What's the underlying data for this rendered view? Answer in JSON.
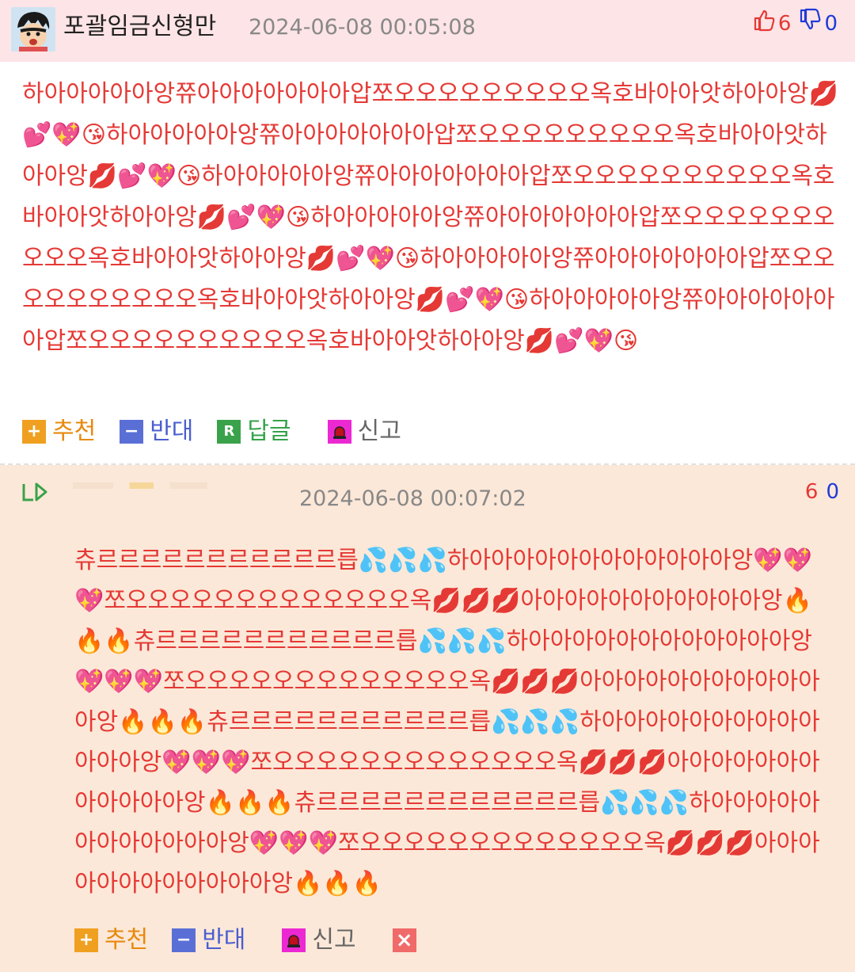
{
  "comment1": {
    "author": "포괄임금신형만",
    "timestamp": "2024-06-08 00:05:08",
    "upvotes": "6",
    "downvotes": "0",
    "body": "하아아아아아앙쮸아아아아아아아압쪼오오오오오오오오오옥호바아아앗하아아앙💋💕💖😘하아아아아아앙쮸아아아아아아아압쪼오오오오오오오오오옥호바아아앗하아아앙💋💕💖😘하아아아아아앙쮸아아아아아아아압쪼오오오오오오오오오오옥호바아아앗하아아앙💋💕💖😘하아아아아아앙쮸아아아아아아아압쪼오오오오오오오오오오옥호바아아앗하아아앙💋💕💖😘하아아아아아앙쮸아아아아아아아압쪼오오오오오오오오오오옥호바아아앗하아아앙💋💕💖😘하아아아아아앙쮸아아아아아아아압쪼오오오오오오오오오오옥호바아아앗하아아앙💋💕💖😘",
    "actions": {
      "recommend": "추천",
      "oppose": "반대",
      "reply": "답글",
      "report": "신고"
    }
  },
  "comment2": {
    "timestamp": "2024-06-08 00:07:02",
    "upvotes": "6",
    "downvotes": "0",
    "body": "츄르르르르르르르르르르르릅💦💦💦하아아아아아아아아아아아아앙💖💖💖쪼오오오오오오오오오오오오오옥💋💋💋아아아아아아아아아아아앙🔥🔥🔥츄르르르르르르르르르르르릅💦💦💦하아아아아아아아아아아아아앙💖💖💖쪼오오오오오오오오오오오오오옥💋💋💋아아아아아아아아아아아아앙🔥🔥🔥츄르르르르르르르르르르르릅💦💦💦하아아아아아아아아아아아아아앙💖💖💖쪼오오오오오오오오오오오오오옥💋💋💋아아아아아아아아아아아아앙🔥🔥🔥츄르르르르르르르르르르르르릅💦💦💦하아아아아아아아아아아아아앙💖💖💖쪼오오오오오오오오오오오오오옥💋💋💋아아아아아아아아아아아아앙🔥🔥🔥",
    "actions": {
      "recommend": "추천",
      "oppose": "반대",
      "report": "신고",
      "delete_icon": "close-icon"
    }
  },
  "colors": {
    "header_bg": "#fde4e6",
    "reply_bg": "#fce8d8",
    "text_red": "#e53935",
    "count_blue": "#1e3ad8"
  }
}
